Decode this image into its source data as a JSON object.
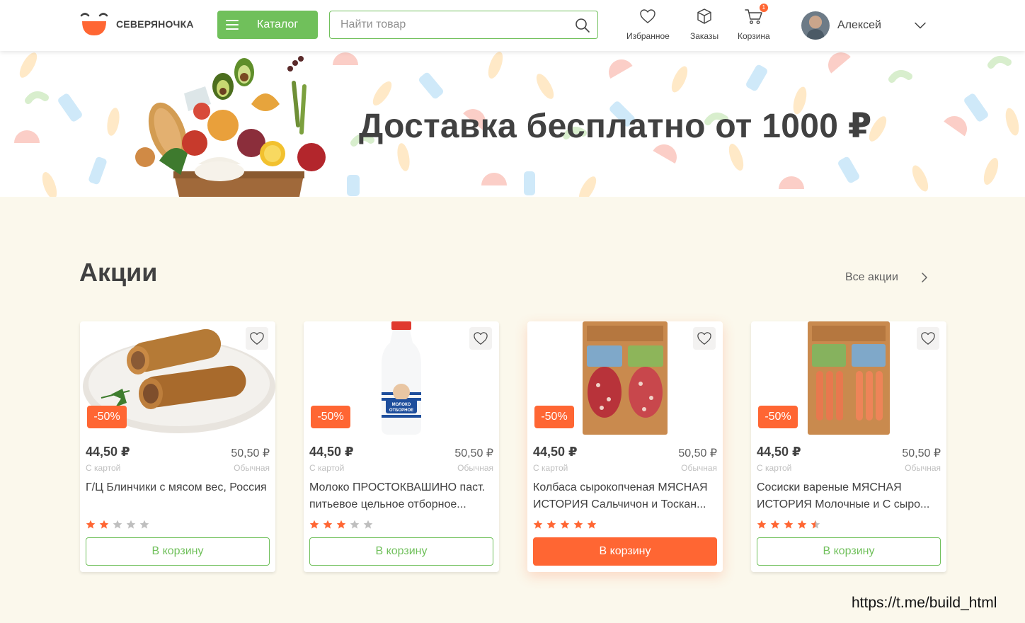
{
  "header": {
    "logo_text": "СЕВЕРЯНОЧКА",
    "catalog_label": "Каталог",
    "search_placeholder": "Найти товар",
    "nav": [
      {
        "label": "Избранное",
        "icon": "heart-icon"
      },
      {
        "label": "Заказы",
        "icon": "box-icon"
      },
      {
        "label": "Корзина",
        "icon": "cart-icon",
        "badge": "1"
      }
    ],
    "user_name": "Алексей"
  },
  "banner": {
    "title": "Доставка бесплатно от 1000 ₽"
  },
  "promo": {
    "title": "Акции",
    "all_link": "Все акции",
    "cards": [
      {
        "discount": "-50%",
        "price_card": "44,50 ₽",
        "price_card_label": "С картой",
        "price_regular": "50,50 ₽",
        "price_regular_label": "Обычная",
        "title": "Г/Ц Блинчики с мясом вес, Россия",
        "rating": 2,
        "button": "В корзину"
      },
      {
        "discount": "-50%",
        "price_card": "44,50 ₽",
        "price_card_label": "С картой",
        "price_regular": "50,50 ₽",
        "price_regular_label": "Обычная",
        "title": "Молоко ПРОСТОКВАШИНО паст. питьевое цельное отборное...",
        "rating": 3,
        "button": "В корзину"
      },
      {
        "discount": "-50%",
        "price_card": "44,50 ₽",
        "price_card_label": "С картой",
        "price_regular": "50,50 ₽",
        "price_regular_label": "Обычная",
        "title": "Колбаса сырокопченая МЯСНАЯ ИСТОРИЯ Сальчичон и Тоскан...",
        "rating": 5,
        "button": "В корзину"
      },
      {
        "discount": "-50%",
        "price_card": "44,50 ₽",
        "price_card_label": "С картой",
        "price_regular": "50,50 ₽",
        "price_regular_label": "Обычная",
        "title": "Сосиски вареные МЯСНАЯ ИСТОРИЯ Молочные и С сыро...",
        "rating": 4.5,
        "button": "В корзину"
      }
    ]
  },
  "watermark": "https://t.me/build_html",
  "colors": {
    "green": "#70C05B",
    "orange": "#FF6633",
    "text": "#414141",
    "bg": "#FBF8EC"
  }
}
